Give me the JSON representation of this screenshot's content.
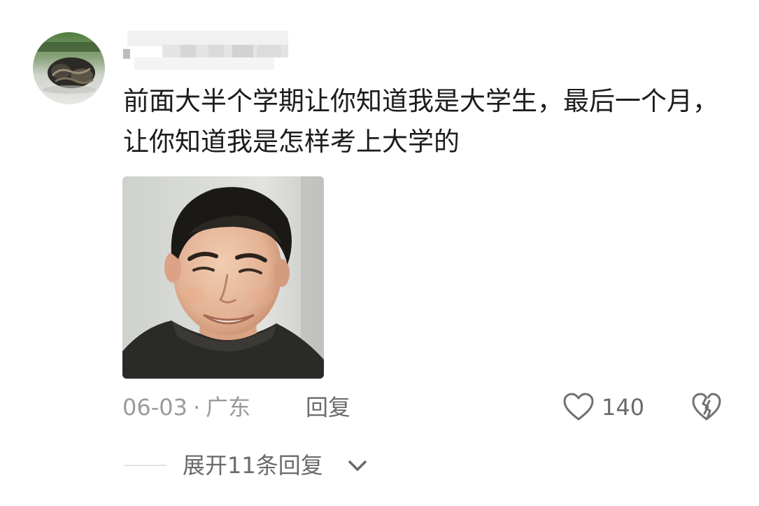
{
  "comment": {
    "text": "前面大半个学期让你知道我是大学生，最后一个月，让你知道我是怎样考上大学的",
    "date": "06-03",
    "separator": "·",
    "location": "广东",
    "reply_label": "回复",
    "like_count": "140",
    "expand_replies_label": "展开11条回复"
  },
  "icons": {
    "like": "heart-outline-icon",
    "dislike": "broken-heart-icon",
    "expand": "chevron-down-icon"
  },
  "colors": {
    "meta_text": "#9a9a9a",
    "action_text": "#6a6a6a",
    "body_text": "#1c1c1c"
  }
}
